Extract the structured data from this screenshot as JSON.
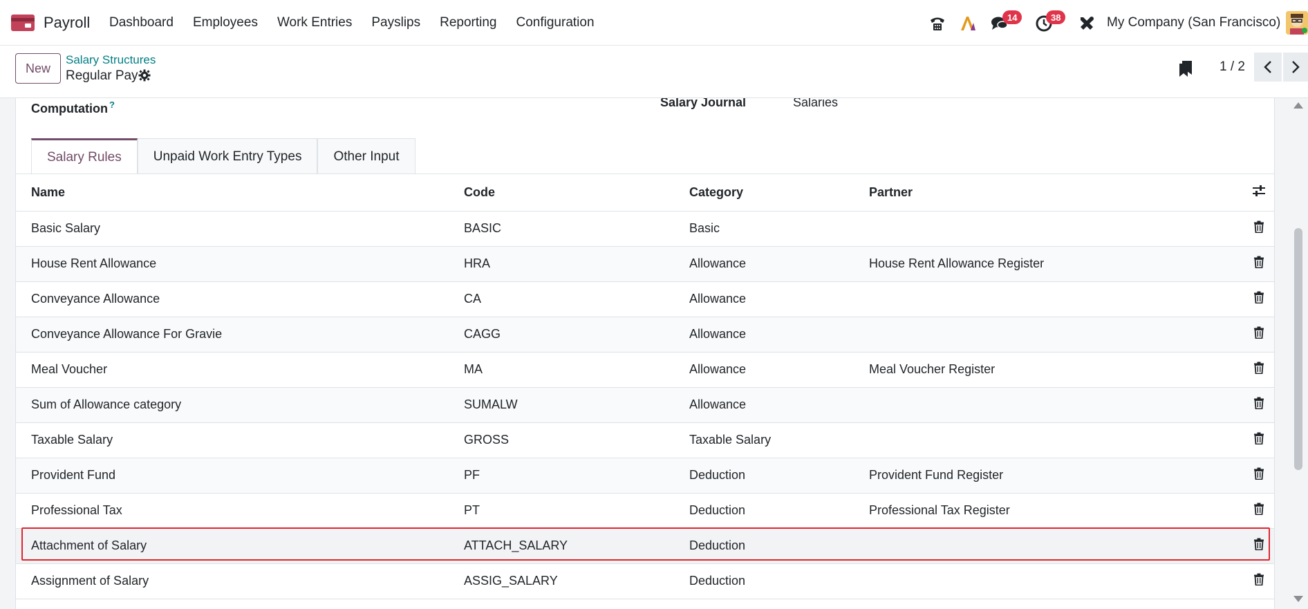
{
  "app": {
    "name": "Payroll",
    "brand_color": "#714b67"
  },
  "menu": [
    "Dashboard",
    "Employees",
    "Work Entries",
    "Payslips",
    "Reporting",
    "Configuration"
  ],
  "systray": {
    "phone_icon": "phone-icon",
    "ai_icon": "ai-icon",
    "messages_count": "14",
    "activities_count": "38",
    "tools_icon": "tools-icon",
    "company": "My Company (San Francisco)"
  },
  "control_panel": {
    "new_label": "New",
    "breadcrumb": "Salary Structures",
    "record_title": "Regular Pay",
    "pager": "1 / 2"
  },
  "form": {
    "computation_label": "Computation",
    "computation_help": "?",
    "journal_label": "Salary Journal",
    "journal_value": "Salaries"
  },
  "tabs": [
    "Salary Rules",
    "Unpaid Work Entry Types",
    "Other Input"
  ],
  "table": {
    "columns": [
      "Name",
      "Code",
      "Category",
      "Partner"
    ],
    "rows": [
      {
        "name": "Basic Salary",
        "code": "BASIC",
        "category": "Basic",
        "partner": ""
      },
      {
        "name": "House Rent Allowance",
        "code": "HRA",
        "category": "Allowance",
        "partner": "House Rent Allowance Register"
      },
      {
        "name": "Conveyance Allowance",
        "code": "CA",
        "category": "Allowance",
        "partner": ""
      },
      {
        "name": "Conveyance Allowance For Gravie",
        "code": "CAGG",
        "category": "Allowance",
        "partner": ""
      },
      {
        "name": "Meal Voucher",
        "code": "MA",
        "category": "Allowance",
        "partner": "Meal Voucher Register"
      },
      {
        "name": "Sum of Allowance category",
        "code": "SUMALW",
        "category": "Allowance",
        "partner": ""
      },
      {
        "name": "Taxable Salary",
        "code": "GROSS",
        "category": "Taxable Salary",
        "partner": ""
      },
      {
        "name": "Provident Fund",
        "code": "PF",
        "category": "Deduction",
        "partner": "Provident Fund Register"
      },
      {
        "name": "Professional Tax",
        "code": "PT",
        "category": "Deduction",
        "partner": "Professional Tax Register"
      },
      {
        "name": "Attachment of Salary",
        "code": "ATTACH_SALARY",
        "category": "Deduction",
        "partner": ""
      },
      {
        "name": "Assignment of Salary",
        "code": "ASSIG_SALARY",
        "category": "Deduction",
        "partner": ""
      }
    ],
    "highlighted_row": 9,
    "highlight_color": "#e0252f"
  }
}
